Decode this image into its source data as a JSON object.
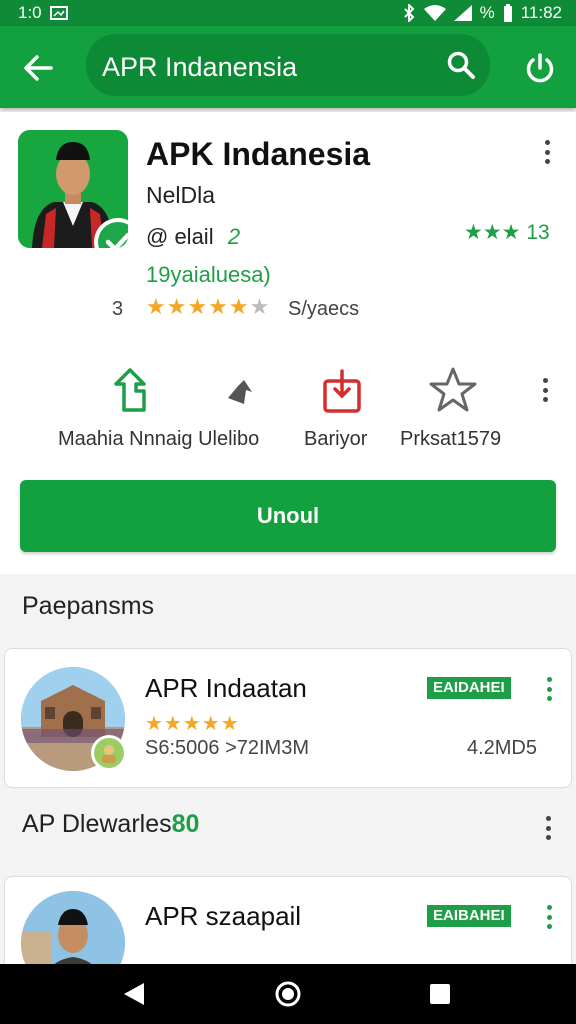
{
  "status_bar": {
    "left_text": "1:0",
    "time": "11:82"
  },
  "search": {
    "query": "APR Indanensia"
  },
  "app": {
    "title": "APK Indanesia",
    "developer": "NelDla",
    "email": "@ elail",
    "email_count": " 2",
    "rating_right_stars": "★★★",
    "rating_right_value": "13",
    "subtitle": "19yaialuesa)",
    "rating_number": "3",
    "stars_filled": "★★★★★",
    "stars_empty": "★",
    "rating_meta": "S/yaecs",
    "stars_value": 4.5
  },
  "actions": {
    "label_1": "Maahia Nnnaig Ulelibo",
    "label_2": "Bariyor",
    "label_3": "Prksat1579"
  },
  "install_button": {
    "label": "Unoul"
  },
  "section1": {
    "title": "Paepansms"
  },
  "list_items": [
    {
      "title": "APR Indaatan",
      "badge": "EAIDAHEI",
      "stars": "★★★★★",
      "meta": "S6:5006  >72IM3M",
      "size": "4.2MD5"
    },
    {
      "title": "APR szaapail",
      "badge": "EAIBAHEI"
    }
  ],
  "section2": {
    "name": "AP Dlewarles",
    "count": "80"
  },
  "colors": {
    "primary": "#13a03f",
    "primary_dark": "#0f8a37",
    "star": "#f5a623",
    "accent_green": "#1e9e46"
  },
  "icons": [
    "back-arrow-icon",
    "search-icon",
    "power-icon",
    "kebab-icon",
    "share-icon",
    "forward-icon",
    "bookmark-icon",
    "star-outline-icon",
    "verified-check-icon",
    "triangle-back-icon",
    "circle-home-icon",
    "square-recents-icon"
  ]
}
